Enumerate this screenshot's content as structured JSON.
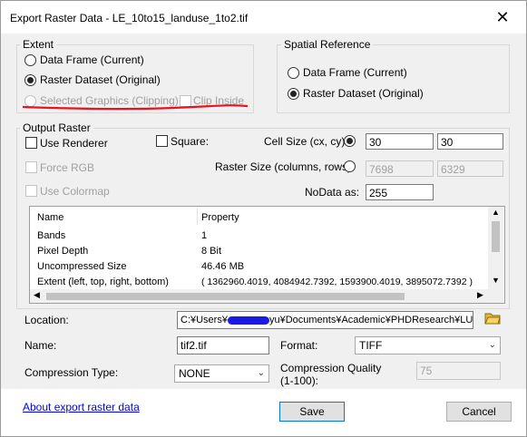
{
  "window": {
    "title": "Export Raster Data - LE_10to15_landuse_1to2.tif",
    "close_glyph": "✕"
  },
  "extent": {
    "legend": "Extent",
    "options": [
      "Data Frame (Current)",
      "Raster Dataset (Original)"
    ],
    "selected_graphics": "Selected Graphics (Clipping)",
    "clip_inside": "Clip Inside"
  },
  "spatial_reference": {
    "legend": "Spatial Reference",
    "options": [
      "Data Frame (Current)",
      "Raster Dataset (Original)"
    ]
  },
  "output_raster": {
    "legend": "Output Raster",
    "use_renderer": "Use Renderer",
    "square": "Square:",
    "force_rgb": "Force RGB",
    "use_colormap": "Use Colormap",
    "cell_size_label": "Cell Size (cx, cy):",
    "cell_size_cx": "30",
    "cell_size_cy": "30",
    "raster_size_label": "Raster Size (columns, rows):",
    "columns": "7698",
    "rows": "6329",
    "nodata_label": "NoData as:",
    "nodata_value": "255"
  },
  "properties_table": {
    "headers": [
      "Name",
      "Property"
    ],
    "rows": [
      [
        "Bands",
        "1"
      ],
      [
        "Pixel Depth",
        "8 Bit"
      ],
      [
        "Uncompressed Size",
        "46.46 MB"
      ],
      [
        "Extent (left, top, right, bottom)",
        "( 1362960.4019, 4084942.7392, 1593900.4019, 3895072.7392 )"
      ]
    ]
  },
  "location": {
    "label": "Location:",
    "prefix": "C:¥Users¥",
    "suffix": "yu¥Documents¥Academic¥PHDResearch¥LUCC"
  },
  "name": {
    "label": "Name:",
    "value": "tif2.tif"
  },
  "format": {
    "label": "Format:",
    "value": "TIFF"
  },
  "compression_type": {
    "label": "Compression Type:",
    "value": "NONE"
  },
  "compression_quality": {
    "label_line1": "Compression Quality",
    "label_line2": "(1-100):",
    "value": "75"
  },
  "footer": {
    "about_link": "About export raster data",
    "save": "Save",
    "cancel": "Cancel"
  },
  "colors": {
    "annotation_red": "#e8131c",
    "redaction_blue": "#1a1ae6",
    "accent_blue": "#0078d7"
  },
  "icons": [
    "close-icon",
    "folder-icon",
    "chevron-down-icon"
  ]
}
